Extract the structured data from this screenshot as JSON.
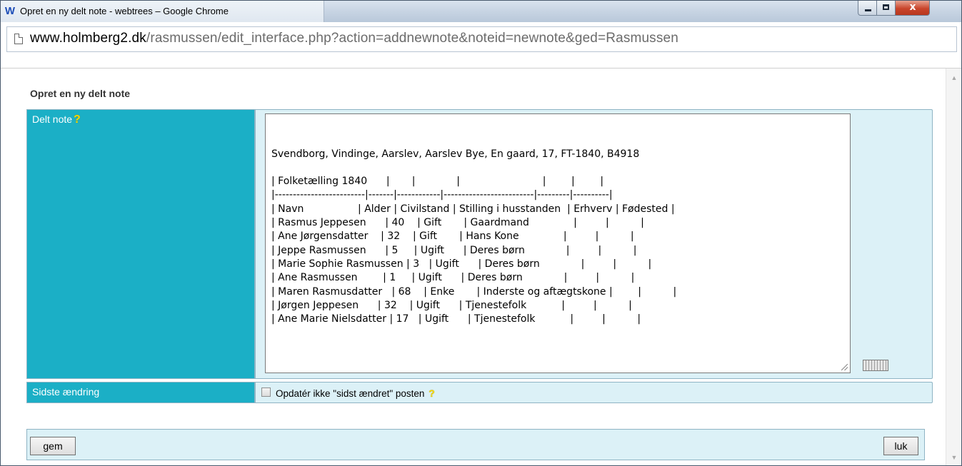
{
  "window": {
    "title": "Opret en ny delt note - webtrees – Google Chrome",
    "app_icon_letter": "W",
    "controls": {
      "close_glyph": "x"
    }
  },
  "address": {
    "host": "www.holmberg2.dk",
    "path": "/rasmussen/edit_interface.php?action=addnewnote&noteid=newnote&ged=Rasmussen"
  },
  "page": {
    "title": "Opret en ny delt note",
    "shared_note_label": "Delt note",
    "help_glyph": "?",
    "note_lines": [
      "Svendborg, Vindinge, Aarslev, Aarslev Bye, En gaard, 17, FT-1840, B4918",
      "",
      "| Folketælling 1840      |       |             |                          |        |        |",
      "|-------------------------|-------|------------|-------------------------|---------|----------|",
      "| Navn                 | Alder | Civilstand | Stilling i husstanden  | Erhverv | Fødested |",
      "| Rasmus Jeppesen      | 40    | Gift       | Gaardmand              |         |          |",
      "| Ane Jørgensdatter    | 32    | Gift       | Hans Kone              |         |          |",
      "| Jeppe Rasmussen      | 5     | Ugift      | Deres børn             |         |          |",
      "| Marie Sophie Rasmussen | 3   | Ugift      | Deres børn             |         |          |",
      "| Ane Rasmussen        | 1     | Ugift      | Deres børn             |         |          |",
      "| Maren Rasmusdatter   | 68    | Enke       | Inderste og aftægtskone |        |          |",
      "| Jørgen Jeppesen      | 32    | Ugift      | Tjenestefolk           |         |          |",
      "| Ane Marie Nielsdatter | 17   | Ugift      | Tjenestefolk           |         |          |"
    ],
    "last_change_label": "Sidste ændring",
    "no_update_checkbox_label": "Opdatér ikke \"sidst ændret\" posten",
    "no_update_checked": false,
    "save_button": "gem",
    "close_button": "luk"
  },
  "colors": {
    "label_bg": "#1bafc6",
    "value_bg": "#dcf1f7"
  }
}
